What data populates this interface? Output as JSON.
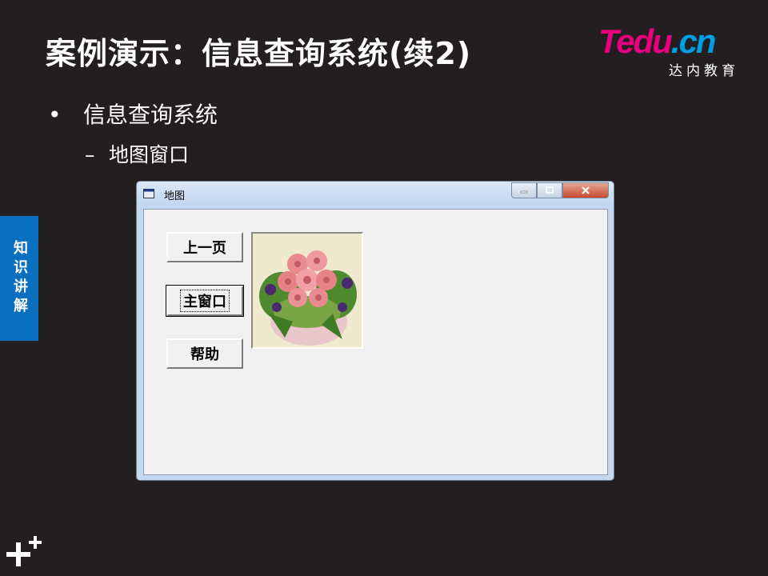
{
  "slide": {
    "title": "案例演示：信息查询系统(续2)",
    "bullet": "信息查询系统",
    "sub_bullet": "地图窗口",
    "bullet_marker": "•",
    "sub_marker": "–",
    "side_tab": "知识讲解"
  },
  "logo": {
    "t": "T",
    "edu": "edu",
    "dot_cn": ".cn",
    "sub": "达内教育",
    "colors": {
      "magenta": "#e6007e",
      "blue": "#009de0"
    }
  },
  "window": {
    "title": "地图",
    "buttons": [
      {
        "label": "上一页"
      },
      {
        "label": "主窗口"
      },
      {
        "label": "帮助"
      }
    ],
    "picture_subject": "rose-bouquet"
  },
  "colors": {
    "background": "#231f20",
    "side_tab": "#0a6fbf"
  }
}
